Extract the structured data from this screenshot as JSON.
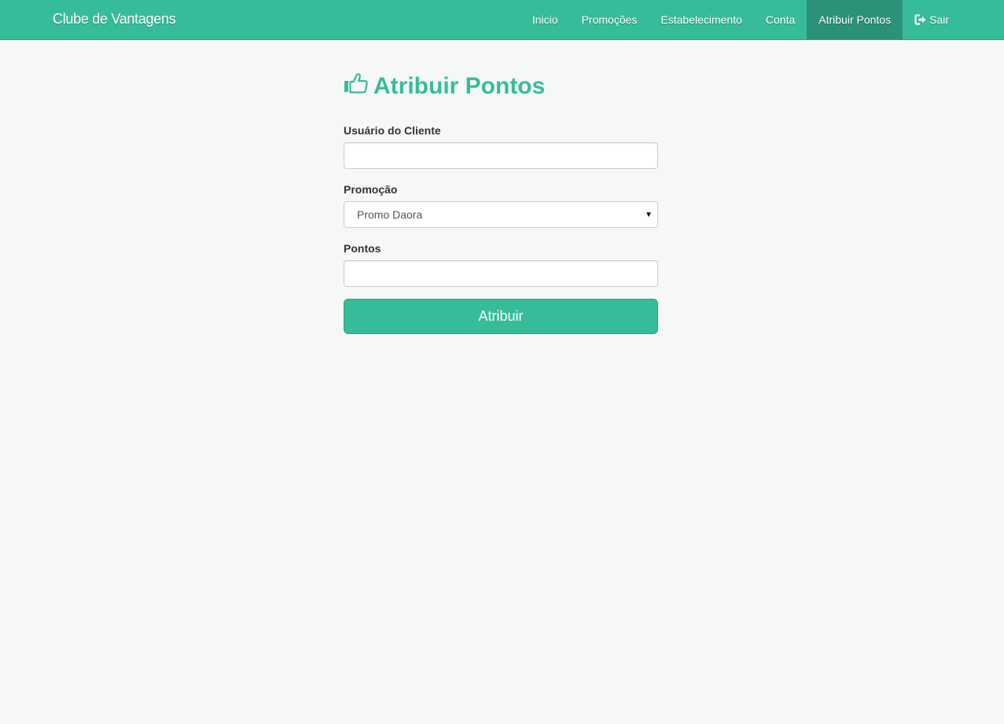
{
  "navbar": {
    "brand": "Clube de Vantagens",
    "items": [
      {
        "label": "Inicio"
      },
      {
        "label": "Promoções"
      },
      {
        "label": "Estabelecimento"
      },
      {
        "label": "Conta"
      },
      {
        "label": "Atribuir Pontos",
        "active": true
      },
      {
        "label": "Sair",
        "icon": "sign-out-icon"
      }
    ]
  },
  "page": {
    "title": "Atribuir Pontos",
    "title_icon": "thumbs-up-icon"
  },
  "form": {
    "cliente_label": "Usuário do Cliente",
    "cliente_value": "",
    "promocao_label": "Promoção",
    "promocao_selected": "Promo Daora",
    "pontos_label": "Pontos",
    "pontos_value": "",
    "submit_label": "Atribuir"
  },
  "colors": {
    "accent": "#37bc9b",
    "nav_active": "#2b9178",
    "background": "#f6f8f7"
  }
}
